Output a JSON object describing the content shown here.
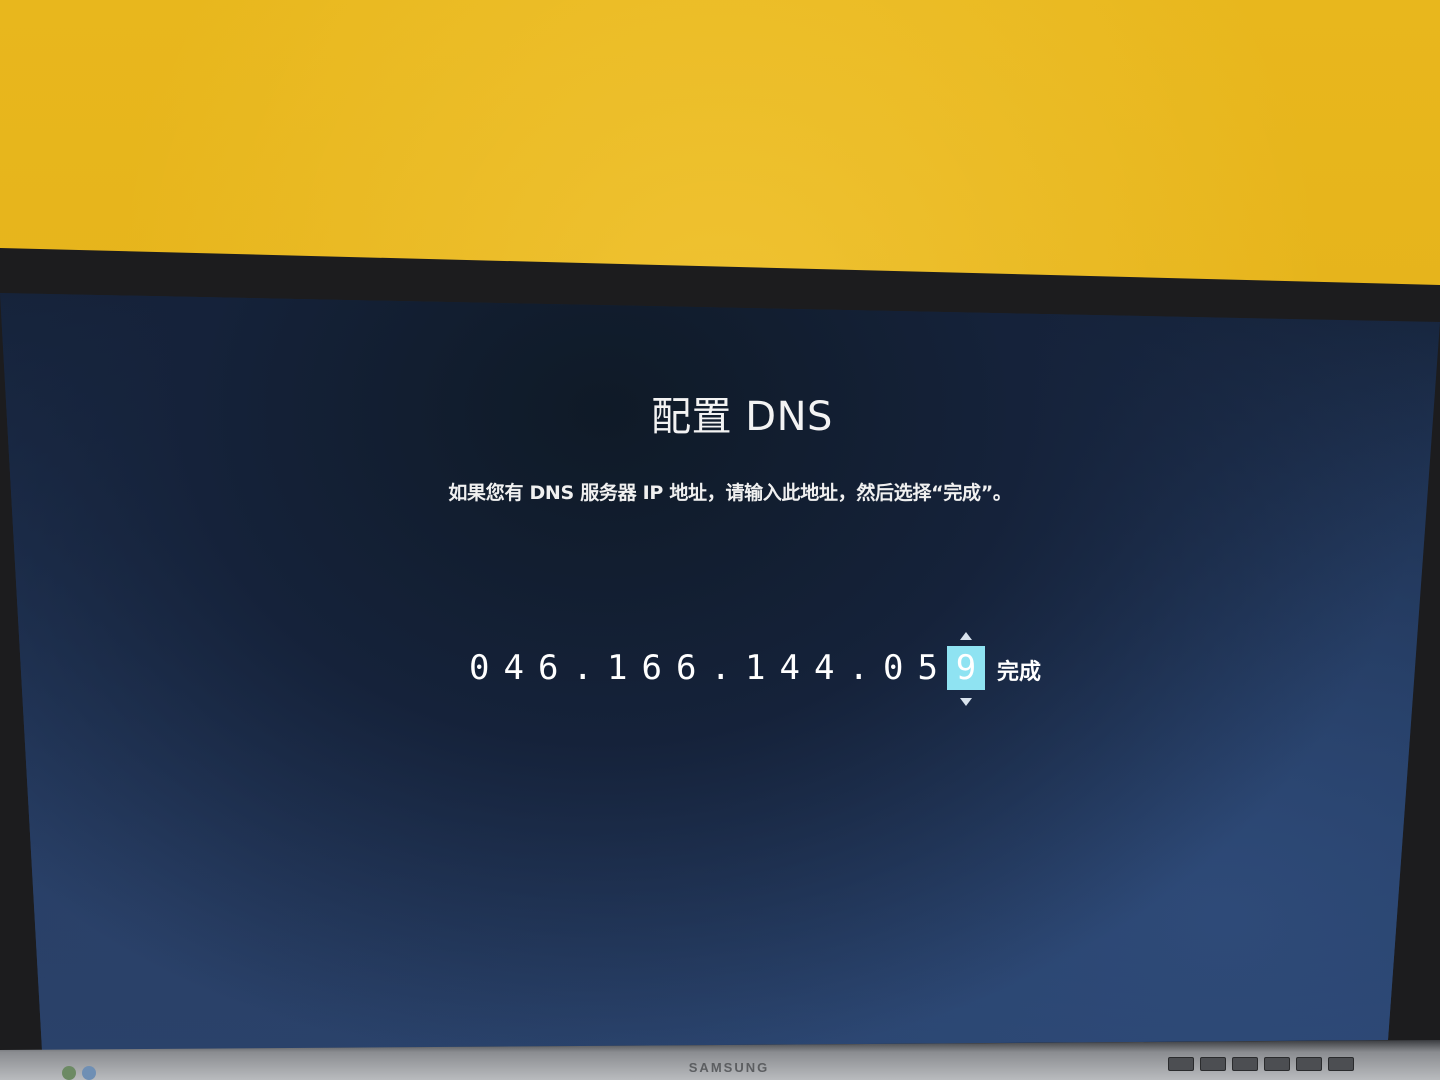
{
  "screen": {
    "title": "配置 DNS",
    "instructions": "如果您有 DNS 服务器 IP 地址，请输入此地址，然后选择“完成”。",
    "ip_digits": [
      "0",
      "4",
      "6",
      ".",
      "1",
      "6",
      "6",
      ".",
      "1",
      "4",
      "4",
      ".",
      "0",
      "5"
    ],
    "active_digit": "9",
    "done_label": "完成"
  },
  "monitor": {
    "brand": "SAMSUNG"
  },
  "colors": {
    "active_digit_bg": "#8fe3f2",
    "screen_bg": "#16243c",
    "wall": "#e5b11a"
  }
}
